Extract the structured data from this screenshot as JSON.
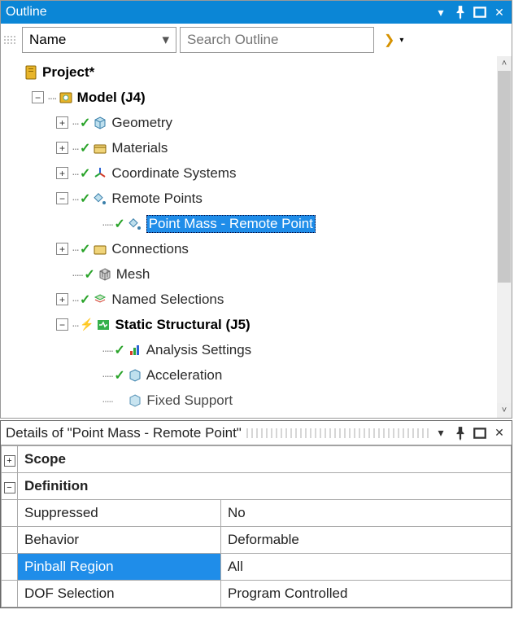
{
  "outline": {
    "title": "Outline",
    "filter": {
      "field": "Name",
      "placeholder": "Search Outline"
    },
    "tree": {
      "root": "Project*",
      "model": "Model (J4)",
      "geometry": "Geometry",
      "materials": "Materials",
      "coord": "Coordinate Systems",
      "remote": "Remote Points",
      "remote_child": "Point Mass - Remote Point",
      "connections": "Connections",
      "mesh": "Mesh",
      "named": "Named Selections",
      "static": "Static Structural (J5)",
      "analysis": "Analysis Settings",
      "accel": "Acceleration",
      "fixed": "Fixed Support"
    }
  },
  "details": {
    "title": "Details of \"Point Mass - Remote Point\"",
    "sections": {
      "scope": "Scope",
      "definition": "Definition"
    },
    "rows": {
      "suppressed_k": "Suppressed",
      "suppressed_v": "No",
      "behavior_k": "Behavior",
      "behavior_v": "Deformable",
      "pinball_k": "Pinball Region",
      "pinball_v": "All",
      "dof_k": "DOF Selection",
      "dof_v": "Program Controlled"
    }
  }
}
